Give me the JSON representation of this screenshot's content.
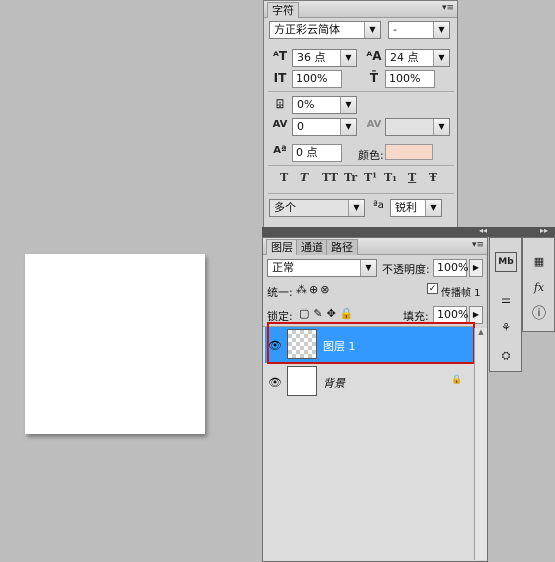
{
  "character_panel": {
    "tab": "字符",
    "font_family": "方正彩云简体",
    "font_style": "-",
    "font_size": "36 点",
    "leading": "24 点",
    "vertical_scale": "100%",
    "horizontal_scale": "100%",
    "tracking_ratio": "0%",
    "kerning": "0",
    "tracking": "",
    "baseline_shift": "0 点",
    "color_label": "颜色:",
    "color_value": "#f8d8c8",
    "format_buttons": [
      "T",
      "T",
      "TT",
      "Tr",
      "T¹",
      "T₁",
      "T",
      "Ŧ"
    ],
    "language": "多个",
    "aa_icon": "ªa",
    "antialias": "锐利"
  },
  "layers_panel": {
    "tabs": [
      "图层",
      "通道",
      "路径"
    ],
    "blend_mode": "正常",
    "opacity_label": "不透明度:",
    "opacity": "100%",
    "unify_label": "统一:",
    "propagate_label": "传播帧 1",
    "lock_label": "锁定:",
    "fill_label": "填充:",
    "fill": "100%",
    "layers": [
      {
        "name": "图层 1",
        "selected": true
      },
      {
        "name": "背景",
        "selected": false
      }
    ]
  },
  "icons": {
    "eye": "eye-icon",
    "lock": "lock-icon"
  },
  "colors": {
    "selection": "#3399ff",
    "highlight_border": "#cc1111"
  }
}
